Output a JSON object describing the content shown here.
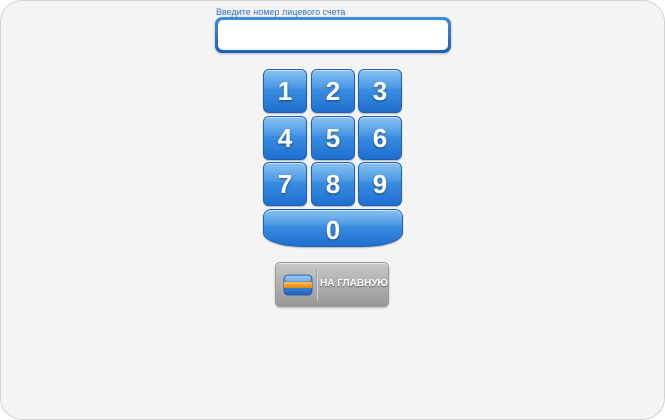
{
  "account": {
    "label": "Введите номер лицевого счета",
    "value": "",
    "placeholder": ""
  },
  "keypad": {
    "keys": [
      "1",
      "2",
      "3",
      "4",
      "5",
      "6",
      "7",
      "8",
      "9",
      "0"
    ]
  },
  "home_button": {
    "label": "НА ГЛАВНУЮ",
    "icon": "home-icon"
  },
  "colors": {
    "key_blue": "#3a8ee2",
    "label_blue": "#2f74c9",
    "background": "#f4f4f4",
    "icon_orange": "#f39a1e"
  }
}
